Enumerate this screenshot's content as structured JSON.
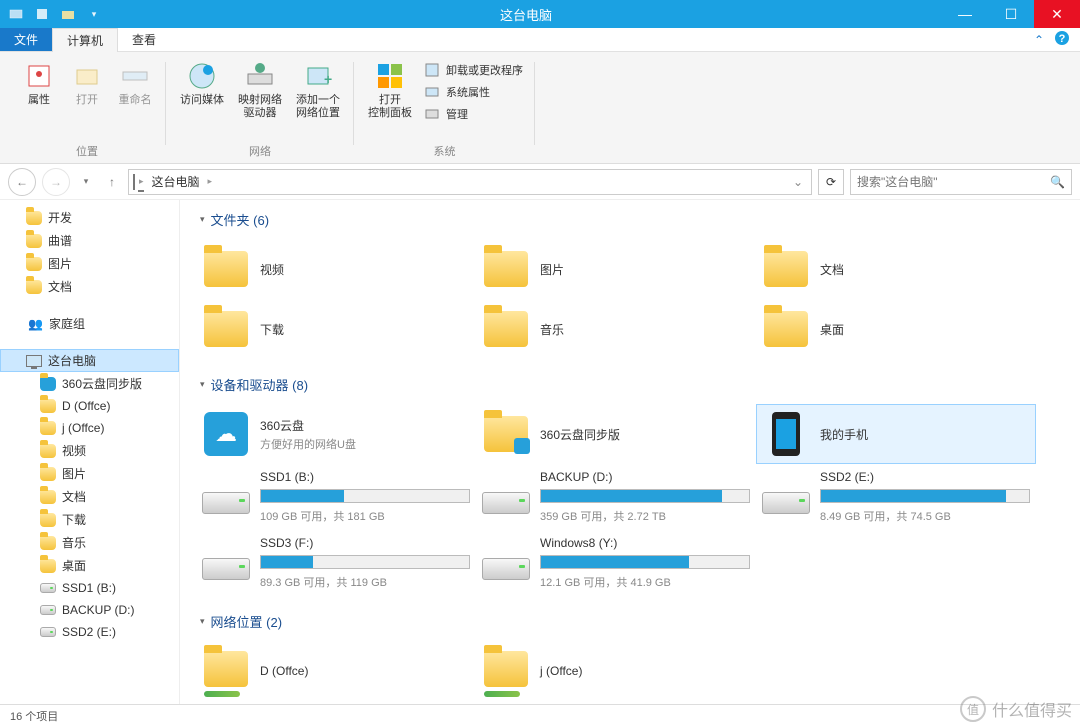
{
  "window": {
    "title": "这台电脑"
  },
  "tabs": {
    "file": "文件",
    "computer": "计算机",
    "view": "查看"
  },
  "ribbon": {
    "location": {
      "label": "位置",
      "properties": "属性",
      "open": "打开",
      "rename": "重命名"
    },
    "network": {
      "label": "网络",
      "access_media": "访问媒体",
      "map_drive": "映射网络\n驱动器",
      "add_location": "添加一个\n网络位置"
    },
    "system": {
      "label": "系统",
      "control_panel": "打开\n控制面板",
      "uninstall": "卸载或更改程序",
      "props": "系统属性",
      "manage": "管理"
    }
  },
  "breadcrumb": {
    "root": "这台电脑"
  },
  "search": {
    "placeholder": "搜索\"这台电脑\""
  },
  "sidebar": {
    "fav": [
      "开发",
      "曲谱",
      "图片",
      "文档"
    ],
    "homegroup": "家庭组",
    "thispc": "这台电脑",
    "pcitems": [
      "360云盘同步版",
      "D (Offce)",
      "j (Offce)",
      "视频",
      "图片",
      "文档",
      "下载",
      "音乐",
      "桌面",
      "SSD1 (B:)",
      "BACKUP (D:)",
      "SSD2 (E:)"
    ]
  },
  "sections": {
    "folders": {
      "title": "文件夹 (6)",
      "items": [
        "视频",
        "图片",
        "文档",
        "下载",
        "音乐",
        "桌面"
      ]
    },
    "devices": {
      "title": "设备和驱动器 (8)",
      "cloud": {
        "name": "360云盘",
        "sub": "方便好用的网络U盘"
      },
      "cloud_sync": "360云盘同步版",
      "phone": "我的手机",
      "drives": [
        {
          "name": "SSD1 (B:)",
          "pct": 40,
          "meta": "109 GB 可用，共 181 GB"
        },
        {
          "name": "BACKUP (D:)",
          "pct": 87,
          "meta": "359 GB 可用，共 2.72 TB"
        },
        {
          "name": "SSD2 (E:)",
          "pct": 89,
          "meta": "8.49 GB 可用，共 74.5 GB"
        },
        {
          "name": "SSD3 (F:)",
          "pct": 25,
          "meta": "89.3 GB 可用，共 119 GB"
        },
        {
          "name": "Windows8 (Y:)",
          "pct": 71,
          "meta": "12.1 GB 可用，共 41.9 GB"
        }
      ]
    },
    "netloc": {
      "title": "网络位置 (2)",
      "items": [
        "D (Offce)",
        "j (Offce)"
      ]
    }
  },
  "status": {
    "count": "16 个项目"
  },
  "watermark": {
    "badge": "值",
    "text": "什么值得买"
  }
}
